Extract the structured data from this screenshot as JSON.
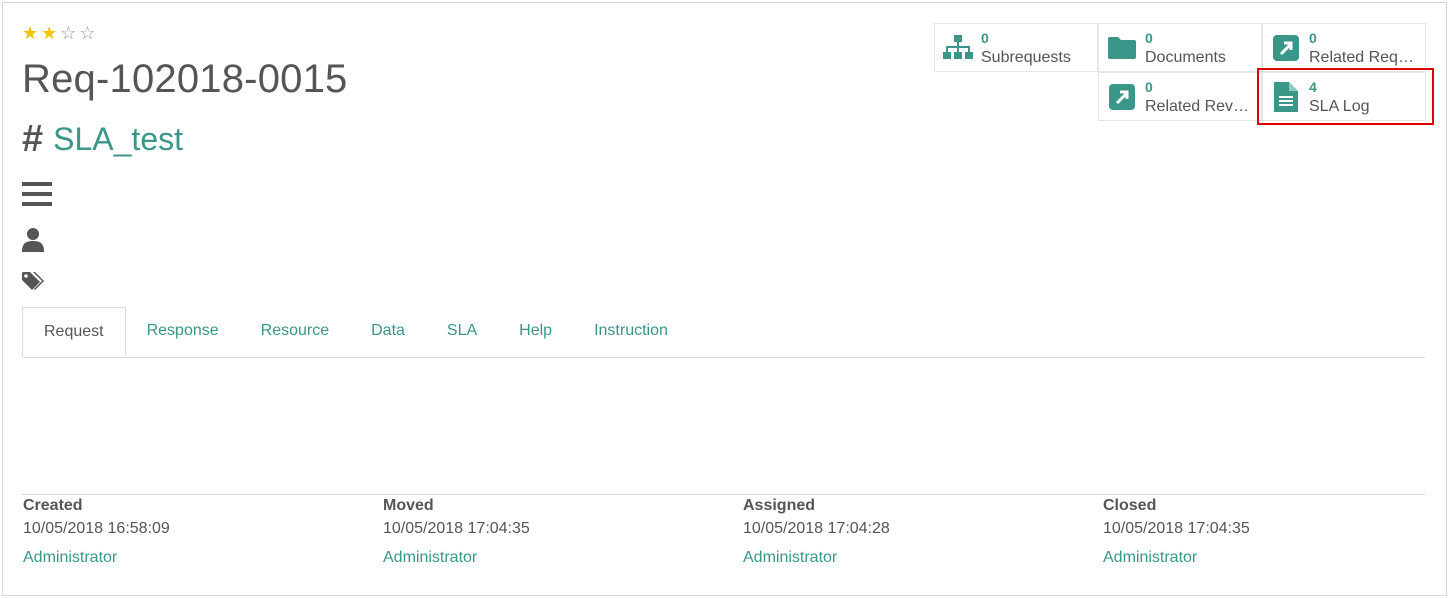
{
  "rating": {
    "stars": [
      {
        "on": true
      },
      {
        "on": true
      },
      {
        "on": false
      },
      {
        "on": false
      }
    ]
  },
  "record": {
    "title": "Req-102018-0015",
    "type_label": "SLA_test"
  },
  "icons": {
    "description": "bars-icon",
    "user": "user-icon",
    "tags": "tags-icon"
  },
  "smart_buttons": {
    "subrequests": {
      "count": "0",
      "label": "Subrequests",
      "icon": "sitemap-icon"
    },
    "documents": {
      "count": "0",
      "label": "Documents",
      "icon": "folder-icon"
    },
    "related_requests": {
      "count": "0",
      "label": "Related Requ...",
      "icon": "arrow-square-icon"
    },
    "related_reverse": {
      "count": "0",
      "label": "Related Rever...",
      "icon": "arrow-square-icon"
    },
    "sla_log": {
      "count": "4",
      "label": "SLA Log",
      "icon": "file-text-icon"
    }
  },
  "highlight_color": "#e00000",
  "accent_color": "#3a9688",
  "tabs": [
    "Request",
    "Response",
    "Resource",
    "Data",
    "SLA",
    "Help",
    "Instruction"
  ],
  "info": [
    {
      "heading": "Created",
      "date": "10/05/2018 16:58:09",
      "user": "Administrator"
    },
    {
      "heading": "Moved",
      "date": "10/05/2018 17:04:35",
      "user": "Administrator"
    },
    {
      "heading": "Assigned",
      "date": "10/05/2018 17:04:28",
      "user": "Administrator"
    },
    {
      "heading": "Closed",
      "date": "10/05/2018 17:04:35",
      "user": "Administrator"
    }
  ]
}
